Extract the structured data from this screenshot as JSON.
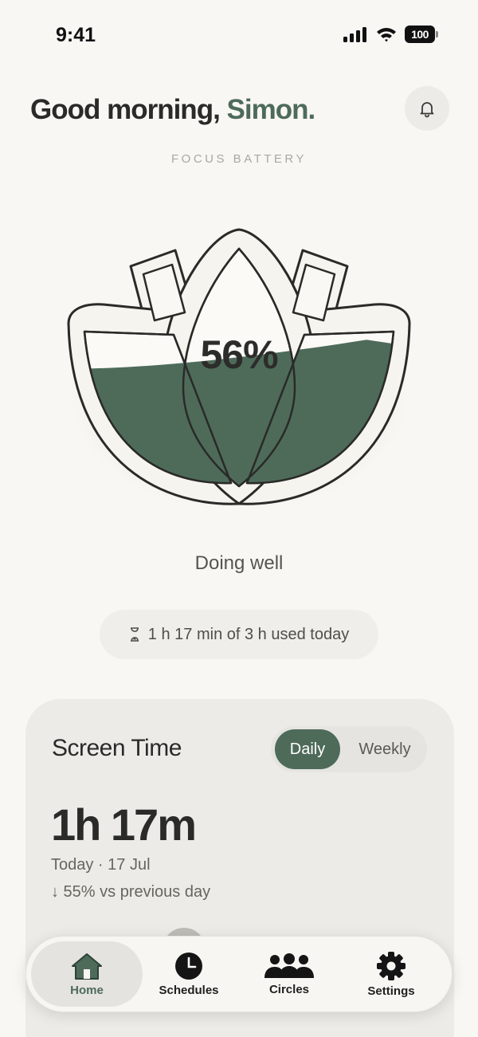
{
  "status_bar": {
    "time": "9:41",
    "battery": "100"
  },
  "header": {
    "greeting": "Good morning, ",
    "name": "Simon",
    "punct": "."
  },
  "focus_battery": {
    "label": "FOCUS BATTERY",
    "percent_text": "56%",
    "level": 0.56,
    "status": "Doing well",
    "usage": "1 h 17 min of 3 h used today",
    "fill_color": "#4e6b5a"
  },
  "screen_time": {
    "title": "Screen Time",
    "tabs": [
      "Daily",
      "Weekly"
    ],
    "selected_tab": "Daily",
    "total": "1h 17m",
    "date": "Today · 17 Jul",
    "change": "↓ 55% vs previous day"
  },
  "tabbar": {
    "items": [
      {
        "label": "Home",
        "icon": "home-icon"
      },
      {
        "label": "Schedules",
        "icon": "clock-icon"
      },
      {
        "label": "Circles",
        "icon": "people-icon"
      },
      {
        "label": "Settings",
        "icon": "gear-icon"
      }
    ],
    "active": "Home"
  },
  "colors": {
    "accent": "#4e6b5a",
    "background": "#f8f7f3",
    "card": "#ecebe7"
  }
}
